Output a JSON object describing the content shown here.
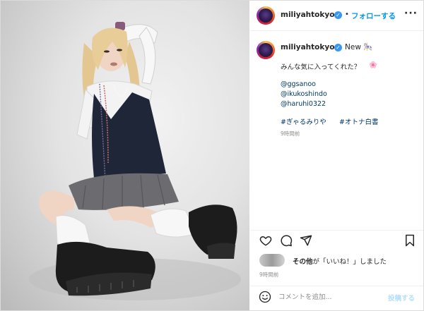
{
  "account": {
    "username": "miliyahtokyo",
    "verified_mark": "✓"
  },
  "header": {
    "separator": "•",
    "follow_label": "フォローする",
    "more_label": "···"
  },
  "caption": {
    "badge": "New",
    "badge_icon": "🎠",
    "line1": "みんな気に入ってくれた？",
    "line1_icon": "🌸",
    "mentions": [
      "@ggsanoo",
      "@ikukoshindo",
      "@haruhi0322"
    ],
    "hashtags": [
      "#ぎゃるみりや",
      "#オトナ白書"
    ],
    "time": "9時間前"
  },
  "actions": {
    "icons": [
      "heart-icon",
      "comment-icon",
      "share-icon",
      "bookmark-icon"
    ]
  },
  "likes": {
    "bold": "その他",
    "rest": "が「いいね！」しました",
    "time": "9時間前"
  },
  "comment": {
    "placeholder": "コメントを追加...",
    "post_label": "投稿する",
    "emoji_icon": "smiley-icon"
  },
  "colors": {
    "accent": "#0095f6",
    "verified": "#3897f0",
    "post_disabled": "#b2dffc",
    "muted": "#8e8e8e"
  }
}
